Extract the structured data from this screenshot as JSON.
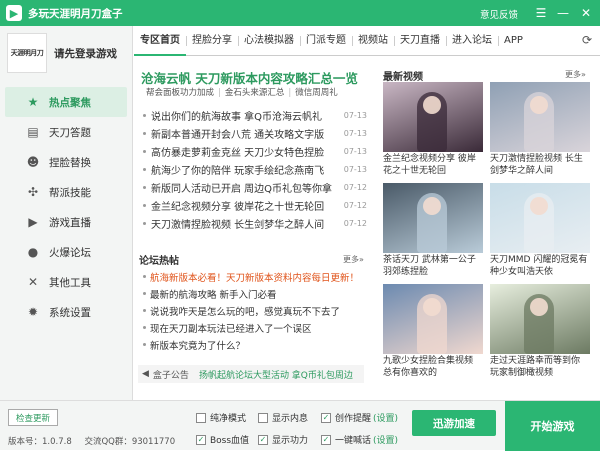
{
  "window": {
    "title": "多玩天涯明月刀盒子",
    "feedback": "意见反馈",
    "logo_glyph": "▶"
  },
  "sidebar": {
    "avatar_text": "天涯明月刀",
    "login_text": "请先登录游戏",
    "items": [
      {
        "label": "热点聚焦",
        "icon": "star-icon",
        "glyph": "★",
        "active": true
      },
      {
        "label": "天刀答题",
        "icon": "book-icon",
        "glyph": "▤",
        "active": false
      },
      {
        "label": "捏脸替换",
        "icon": "face-icon",
        "glyph": "☻",
        "active": false
      },
      {
        "label": "帮派技能",
        "icon": "pinwheel-icon",
        "glyph": "✣",
        "active": false
      },
      {
        "label": "游戏直播",
        "icon": "play-icon",
        "glyph": "▶",
        "active": false
      },
      {
        "label": "火爆论坛",
        "icon": "chat-icon",
        "glyph": "●",
        "active": false
      },
      {
        "label": "其他工具",
        "icon": "tools-icon",
        "glyph": "✕",
        "active": false
      },
      {
        "label": "系统设置",
        "icon": "gear-icon",
        "glyph": "✹",
        "active": false
      }
    ]
  },
  "tabs": [
    {
      "label": "专区首页",
      "active": true
    },
    {
      "label": "捏脸分享",
      "active": false
    },
    {
      "label": "心法模拟器",
      "active": false
    },
    {
      "label": "门派专题",
      "active": false
    },
    {
      "label": "视频站",
      "active": false
    },
    {
      "label": "天刀直播",
      "active": false
    },
    {
      "label": "进入论坛",
      "active": false
    },
    {
      "label": "APP",
      "active": false
    }
  ],
  "main": {
    "headline": "沧海云帆 天刀新版本内容攻略汇总一览",
    "sublinks": [
      "帮会面板功力加成",
      "金石头来源汇总",
      "微信周周礼"
    ],
    "news": [
      {
        "title": "说出你们的航海故事 拿Q币沧海云帆礼",
        "date": "07-13"
      },
      {
        "title": "新副本普通开封会八荒 通关攻略文字版",
        "date": "07-13"
      },
      {
        "title": "高仿暴走萝莉金克丝 天刀少女特色捏脸",
        "date": "07-13"
      },
      {
        "title": "航海少了你的陪伴 玩家手绘纪念燕南飞",
        "date": "07-13"
      },
      {
        "title": "新版同人活动已开启 周边Q币礼包等你拿",
        "date": "07-12"
      },
      {
        "title": "金兰纪念视频分享 彼岸花之十世无轮回",
        "date": "07-12"
      },
      {
        "title": "天刀激情捏脸视频 长生剑梦华之醉人间",
        "date": "07-12"
      }
    ],
    "forum_title": "论坛热帖",
    "forum": [
      {
        "title": "航海新版本必看！天刀新版本资料内容每日更新！",
        "hot": true
      },
      {
        "title": "最新的航海攻略 新手入门必看",
        "hot": false
      },
      {
        "title": "说说我咋天是怎么玩的吧，感觉真玩不下去了",
        "hot": false
      },
      {
        "title": "现在天刀副本玩法已经进入了一个误区",
        "hot": false
      },
      {
        "title": "新版本究竟为了什么？",
        "hot": false
      }
    ],
    "notice_label": "盒子公告",
    "notice_msg": "扬帆起航论坛大型活动 拿Q币礼包周边",
    "more_label": "更多»"
  },
  "videos": {
    "title": "最新视频",
    "items": [
      {
        "caption": "金兰纪念视频分享 彼岸花之十世无轮回",
        "bg": "#c9b7c4",
        "fg": "#3a2a38"
      },
      {
        "caption": "天刀激情捏脸视频 长生剑梦华之醉人间",
        "bg": "#8fa0b4",
        "fg": "#d9d4da"
      },
      {
        "caption": "茶话天刀 武林第一公子羽郊练捏脸",
        "bg": "#4a5a68",
        "fg": "#b9cbd8"
      },
      {
        "caption": "天刀MMD 闪耀的冠冕有种少女叫浩天依",
        "bg": "#c8dde8",
        "fg": "#e8eef2"
      },
      {
        "caption": "九歌少女捏脸合集视频 总有你喜欢的",
        "bg": "#6c8ab0",
        "fg": "#f0d8cf"
      },
      {
        "caption": "走过天涯路幸而等到你 玩家制御橄视频",
        "bg": "#e7eede",
        "fg": "#6c7a62"
      }
    ]
  },
  "bottom": {
    "check_update": "检查更新",
    "version": "版本号：1.0.7.8",
    "qq_group": "交流QQ群：93011770",
    "options": [
      {
        "label": "纯净模式",
        "checked": false,
        "link": ""
      },
      {
        "label": "显示内息",
        "checked": false,
        "link": ""
      },
      {
        "label": "创作提醒",
        "checked": true,
        "link": "(设置)"
      },
      {
        "label": "Boss血值",
        "checked": true,
        "link": ""
      },
      {
        "label": "显示功力",
        "checked": true,
        "link": ""
      },
      {
        "label": "一键喊话",
        "checked": true,
        "link": "(设置)"
      }
    ],
    "speed_button": "迅游加速",
    "start_button": "开始游戏"
  }
}
